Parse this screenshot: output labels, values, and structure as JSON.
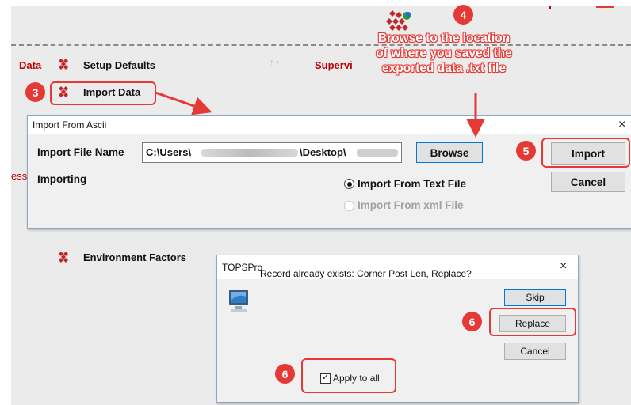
{
  "background": {
    "menu_prefix": "Data",
    "setup_defaults": "Setup Defaults",
    "supervisor_partial": "Supervi",
    "import_data": "Import Data",
    "left_cut_text": "ess",
    "environment_factors": "Environment Factors"
  },
  "steps": {
    "step3": "3",
    "step4": "4",
    "step5": "5",
    "step6a": "6",
    "step6b": "6"
  },
  "callout": {
    "line1": "Browse to the location",
    "line2": "of where you saved the",
    "line3": "exported data .txt file"
  },
  "import_dialog": {
    "title": "Import From Ascii",
    "close": "×",
    "file_label": "Import File Name",
    "file_value_start": "C:\\Users\\",
    "file_value_mid": "\\Desktop\\",
    "browse": "Browse",
    "import": "Import",
    "cancel": "Cancel",
    "importing_label": "Importing",
    "option_text": "Import From Text File",
    "option_xml": "Import From xml File"
  },
  "tops_dialog": {
    "title": "TOPSPro",
    "close": "×",
    "message": "Record already exists: Corner Post Len, Replace?",
    "skip": "Skip",
    "replace": "Replace",
    "cancel": "Cancel",
    "apply_all": "Apply to all",
    "apply_all_checked": true
  },
  "colors": {
    "accent": "#e53935",
    "menu_red": "#c00000"
  }
}
